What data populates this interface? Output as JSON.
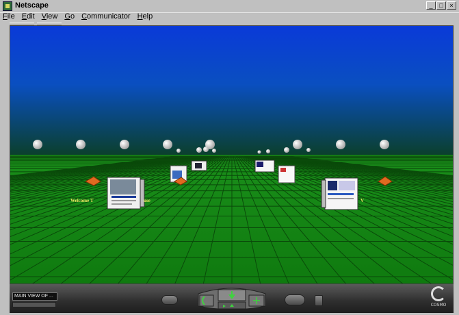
{
  "window": {
    "title": "Netscape",
    "controls": [
      "_",
      "□",
      "×"
    ]
  },
  "menu": [
    {
      "label": "File",
      "u": "F",
      "rest": "ile"
    },
    {
      "label": "Edit",
      "u": "E",
      "rest": "dit"
    },
    {
      "label": "View",
      "u": "V",
      "rest": "iew"
    },
    {
      "label": "Go",
      "u": "G",
      "rest": "o"
    },
    {
      "label": "Communicator",
      "u": "C",
      "rest": "ommunicator"
    },
    {
      "label": "Help",
      "u": "H",
      "rest": "elp"
    }
  ],
  "scene": {
    "sky_top": "#0a3ad8",
    "sky_bottom": "#0b3f2a",
    "ground": "#138a13",
    "grid_line": "#0a4a0a",
    "welcome_text": "Welcome T",
    "welcome_text_2": "use",
    "right_label": "V",
    "sign_color": "#e06a20"
  },
  "dashboard": {
    "view_label": "MAIN VIEW OF ...",
    "logo_text": "COSMO",
    "accent": "#3fd23f"
  }
}
